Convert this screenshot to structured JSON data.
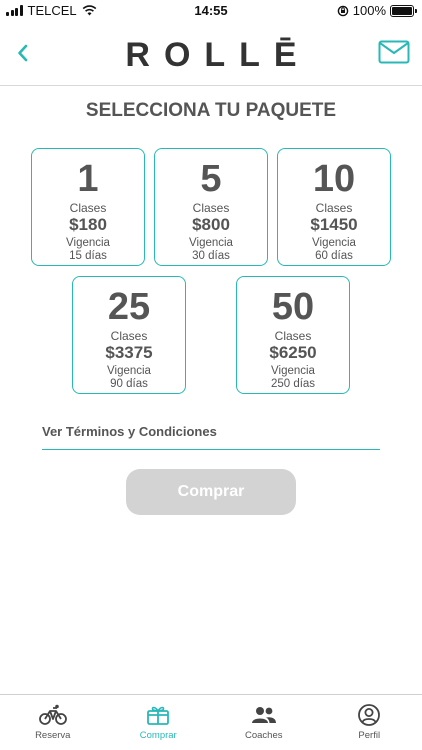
{
  "status_bar": {
    "carrier": "TELCEL",
    "time": "14:55",
    "battery_percent": "100%"
  },
  "header": {
    "logo": "ROLLĒ",
    "back_icon": "chevron-left-icon",
    "mail_icon": "mail-icon"
  },
  "title": "SELECCIONA TU PAQUETE",
  "packages": [
    {
      "count": "1",
      "unit": "Clases",
      "price": "$180",
      "validity_label": "Vigencia",
      "validity": "15 días"
    },
    {
      "count": "5",
      "unit": "Clases",
      "price": "$800",
      "validity_label": "Vigencia",
      "validity": "30 días"
    },
    {
      "count": "10",
      "unit": "Clases",
      "price": "$1450",
      "validity_label": "Vigencia",
      "validity": "60 días"
    },
    {
      "count": "25",
      "unit": "Clases",
      "price": "$3375",
      "validity_label": "Vigencia",
      "validity": "90 días"
    },
    {
      "count": "50",
      "unit": "Clases",
      "price": "$6250",
      "validity_label": "Vigencia",
      "validity": "250 días"
    }
  ],
  "terms_link": "Ver Términos y Condiciones",
  "buy_button": "Comprar",
  "tabbar": {
    "tabs": [
      {
        "label": "Reserva",
        "icon": "bicycle-icon"
      },
      {
        "label": "Comprar",
        "icon": "gift-icon"
      },
      {
        "label": "Coaches",
        "icon": "people-icon"
      },
      {
        "label": "Perfil",
        "icon": "user-circle-icon"
      }
    ],
    "active": "Comprar"
  },
  "colors": {
    "accent": "#29b8b8",
    "text": "#555555",
    "button_disabled": "#d3d3d3"
  }
}
